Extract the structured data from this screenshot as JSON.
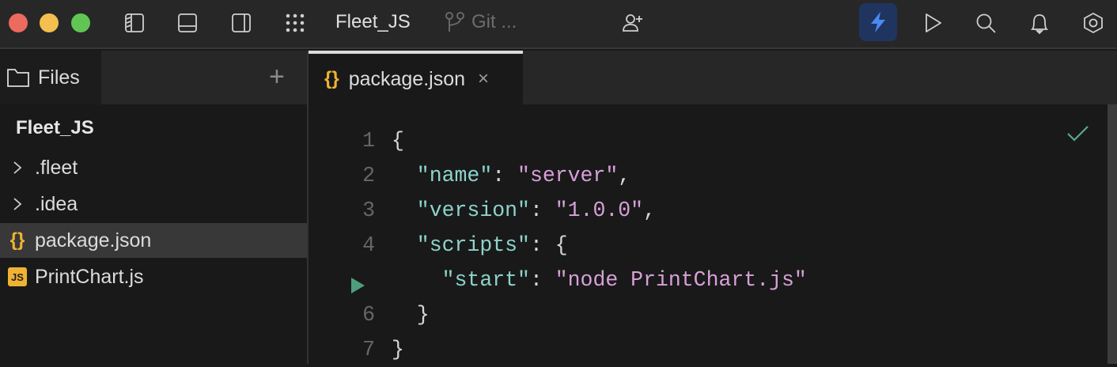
{
  "titlebar": {
    "project": "Fleet_JS",
    "git_label": "Git ...",
    "colors": {
      "close": "#ec6a5e",
      "minimize": "#f4bf4f",
      "zoom": "#61c554",
      "accent": "#4a8af4"
    }
  },
  "sidebar": {
    "tab_label": "Files",
    "root": "Fleet_JS",
    "items": [
      {
        "label": ".fleet",
        "type": "folder"
      },
      {
        "label": ".idea",
        "type": "folder"
      },
      {
        "label": "package.json",
        "type": "json",
        "selected": true
      },
      {
        "label": "PrintChart.js",
        "type": "js",
        "badge": "JS"
      }
    ]
  },
  "editor": {
    "tab_label": "package.json",
    "close": "×",
    "lines": [
      {
        "n": "1",
        "tokens": [
          {
            "t": "{",
            "c": "p"
          }
        ]
      },
      {
        "n": "2",
        "tokens": [
          {
            "t": "  \"name\"",
            "c": "k"
          },
          {
            "t": ": ",
            "c": "p"
          },
          {
            "t": "\"server\"",
            "c": "s"
          },
          {
            "t": ",",
            "c": "p"
          }
        ]
      },
      {
        "n": "3",
        "tokens": [
          {
            "t": "  \"version\"",
            "c": "k"
          },
          {
            "t": ": ",
            "c": "p"
          },
          {
            "t": "\"1.0.0\"",
            "c": "s"
          },
          {
            "t": ",",
            "c": "p"
          }
        ]
      },
      {
        "n": "4",
        "tokens": [
          {
            "t": "  \"scripts\"",
            "c": "k"
          },
          {
            "t": ": {",
            "c": "p"
          }
        ]
      },
      {
        "n": "",
        "run": true,
        "tokens": [
          {
            "t": "    \"start\"",
            "c": "k"
          },
          {
            "t": ": ",
            "c": "p"
          },
          {
            "t": "\"node PrintChart.js\"",
            "c": "s"
          }
        ]
      },
      {
        "n": "6",
        "tokens": [
          {
            "t": "  }",
            "c": "p"
          }
        ]
      },
      {
        "n": "7",
        "tokens": [
          {
            "t": "}",
            "c": "p"
          }
        ]
      }
    ]
  }
}
